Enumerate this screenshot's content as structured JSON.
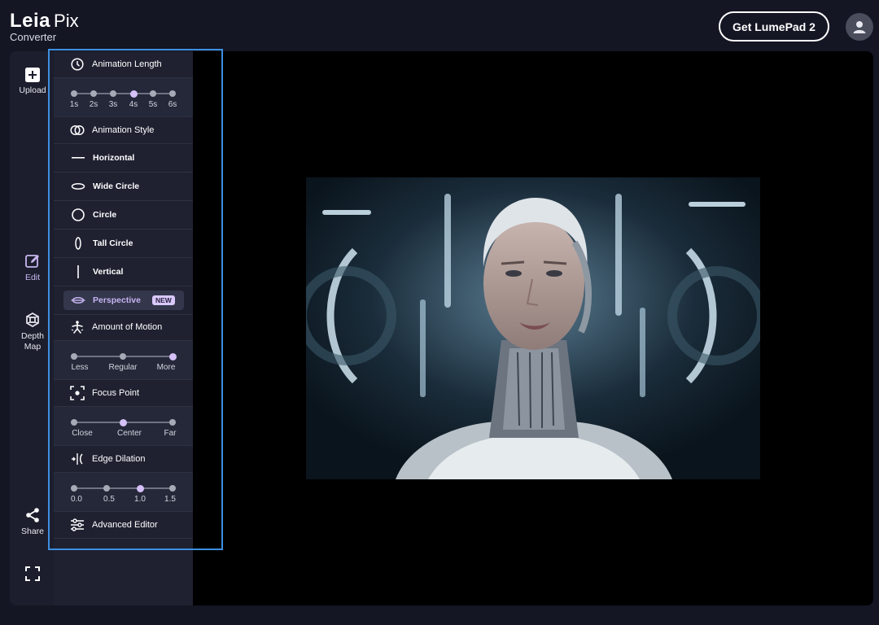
{
  "header": {
    "logo_main": "Leia",
    "logo_pix": "Pix",
    "logo_sub": "Converter",
    "cta_label": "Get LumePad 2"
  },
  "rail": {
    "upload": "Upload",
    "edit": "Edit",
    "depth_map": "Depth Map",
    "share": "Share"
  },
  "panel": {
    "animation_length": {
      "title": "Animation Length",
      "ticks": [
        "1s",
        "2s",
        "3s",
        "4s",
        "5s",
        "6s"
      ],
      "selected_index": 3
    },
    "animation_style": {
      "title": "Animation Style",
      "items": [
        "Horizontal",
        "Wide Circle",
        "Circle",
        "Tall Circle",
        "Vertical",
        "Perspective"
      ],
      "selected": "Perspective",
      "badge": "NEW"
    },
    "amount_of_motion": {
      "title": "Amount of Motion",
      "ticks": [
        "Less",
        "Regular",
        "More"
      ],
      "selected_index": 2
    },
    "focus_point": {
      "title": "Focus Point",
      "ticks": [
        "Close",
        "Center",
        "Far"
      ],
      "selected_index": 1
    },
    "edge_dilation": {
      "title": "Edge Dilation",
      "ticks": [
        "0.0",
        "0.5",
        "1.0",
        "1.5"
      ],
      "selected_index": 2
    },
    "advanced_editor": {
      "title": "Advanced Editor"
    }
  },
  "colors": {
    "accent": "#c6b3f2",
    "highlight_border": "#3d8fe0",
    "panel_bg": "#1f2131",
    "page_bg": "#141624"
  }
}
